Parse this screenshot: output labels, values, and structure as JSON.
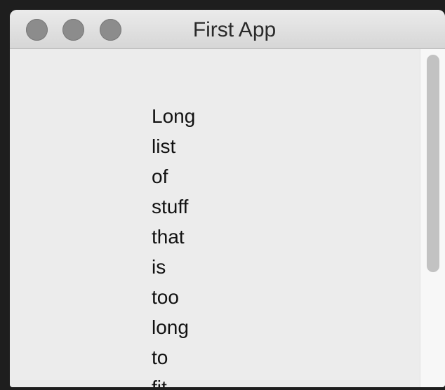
{
  "window": {
    "title": "First App",
    "controls": {
      "close_icon": "close-button-icon",
      "minimize_icon": "minimize-button-icon",
      "zoom_icon": "zoom-button-icon",
      "color": "#8c8c8c"
    }
  },
  "content": {
    "lines": [
      "Long",
      "list",
      "of",
      "stuff",
      "that",
      "is",
      "too",
      "long",
      "to",
      "fit"
    ]
  },
  "scrollbar": {
    "position": 0,
    "visible_fraction": 0.68
  }
}
